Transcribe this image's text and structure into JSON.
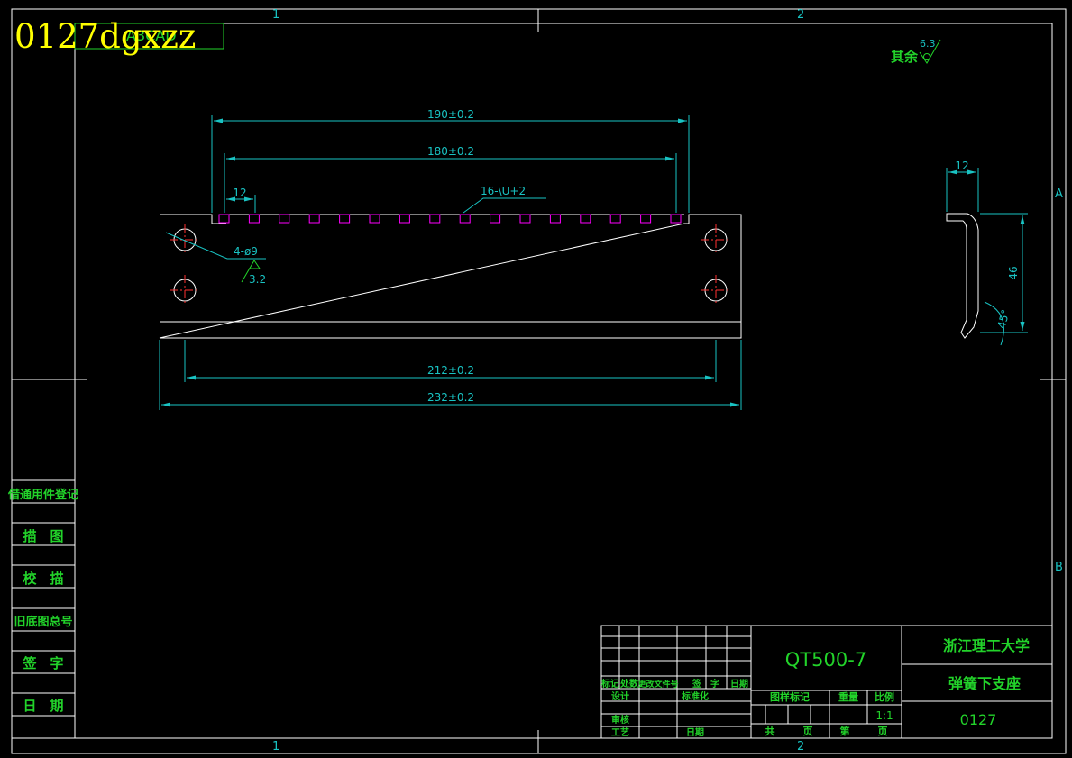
{
  "watermark": {
    "text": "0127dgxzz",
    "behind_text": "A3CAD",
    "color": "#ffff00"
  },
  "colors": {
    "frame": "#ffffff",
    "dimension": "#19c3c3",
    "text": "#22d32a",
    "centerline": "#ff3030",
    "slot": "#ff00ff",
    "background": "#000000"
  },
  "zone_marks": {
    "top": [
      "1",
      "2"
    ],
    "bottom": [
      "1",
      "2"
    ],
    "right": [
      "A",
      "B"
    ]
  },
  "roughness": {
    "label": "其余",
    "value": "6.3"
  },
  "front_view": {
    "dims": {
      "overall_top": "190±0.2",
      "slots_span": "180±0.2",
      "slot_pitch": "12",
      "slot_note": "16-\\U+2",
      "holes_note": "4-ø9",
      "holes_roughness": "3.2",
      "hole_center_span": "212±0.2",
      "overall_width": "232±0.2"
    },
    "slot_count": 16,
    "hole_count": 4
  },
  "side_view": {
    "dims": {
      "width": "12",
      "height": "46",
      "angle": "45°"
    }
  },
  "left_column": [
    "借通用件登记",
    "描　图",
    "校　描",
    "旧底图总号",
    "签　字",
    "日　期"
  ],
  "title_block": {
    "material": "QT500-7",
    "school": "浙江理工大学",
    "part_name": "弹簧下支座",
    "drawing_no": "0127",
    "rev_headers": [
      "标记",
      "处数",
      "更改文件号",
      "签　字",
      "日期"
    ],
    "design": "设计",
    "standardize": "标准化",
    "review": "审核",
    "process": "工艺",
    "date": "日期",
    "stage_mark": "图样标记",
    "weight": "重量",
    "scale_label": "比例",
    "scale_value": "1:1",
    "total_label": "共",
    "sheet_unit": "页",
    "page_label": "第",
    "page_unit": "页"
  }
}
